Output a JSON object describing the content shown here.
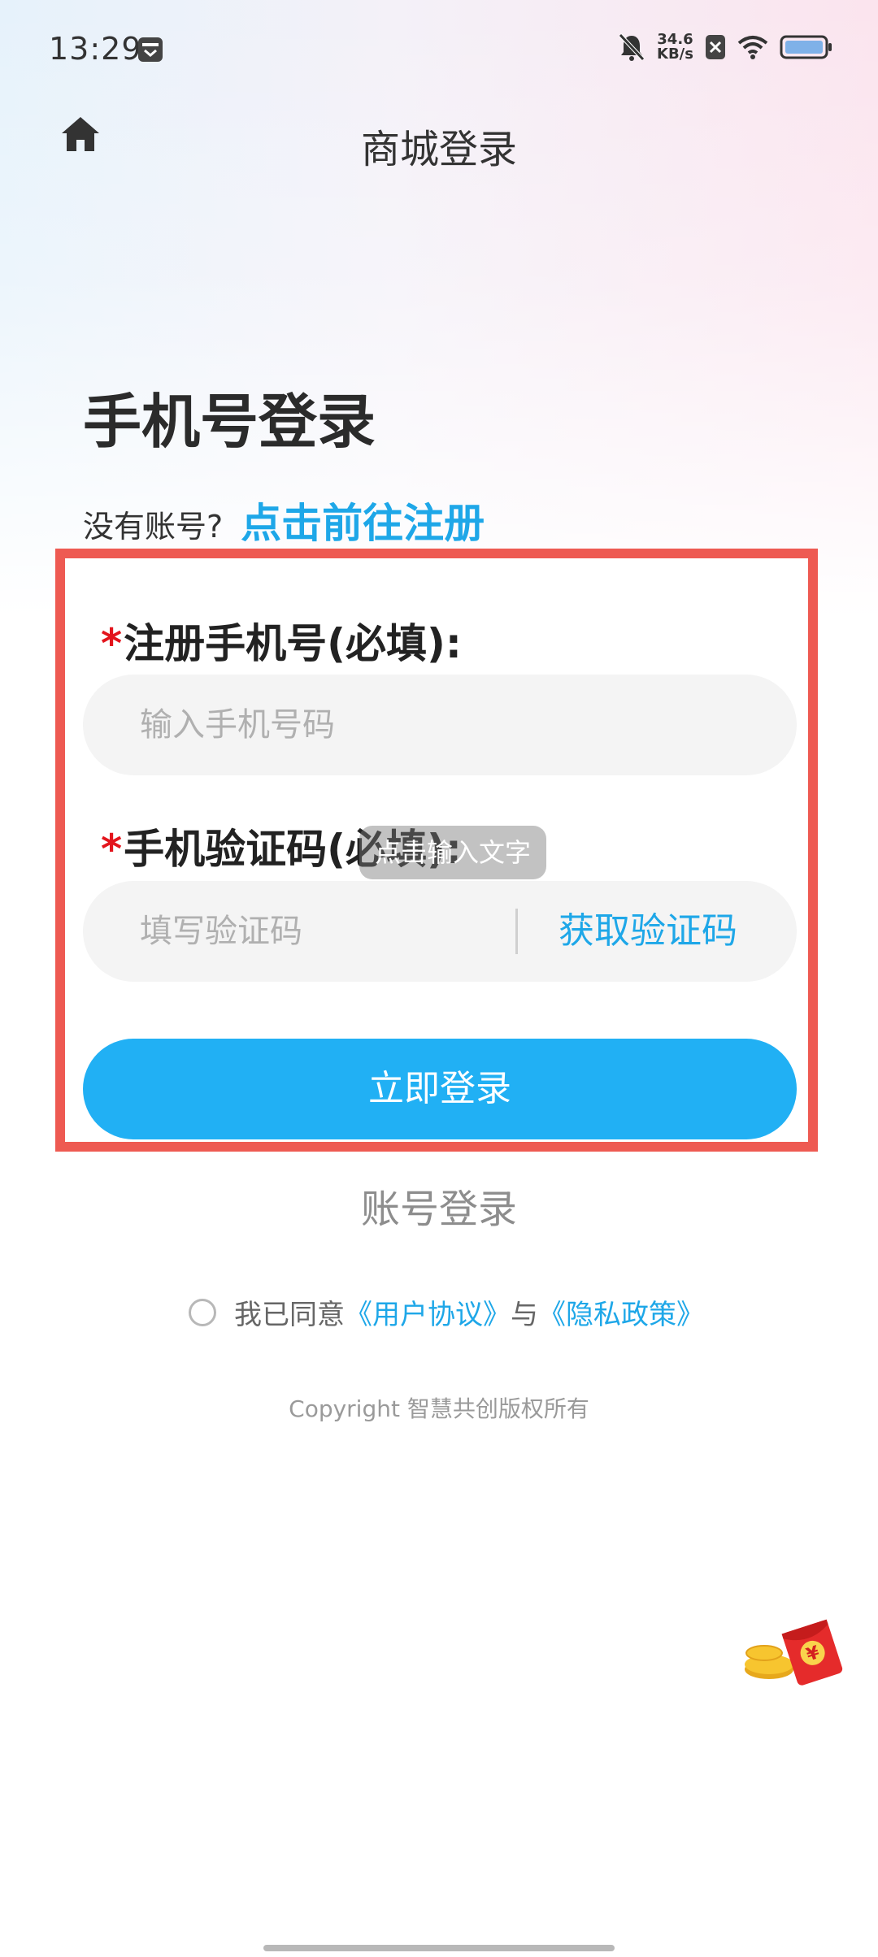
{
  "status_bar": {
    "time": "13:29",
    "net_speed_value": "34.6",
    "net_speed_unit": "KB/s",
    "icons": [
      "calendar-icon",
      "mute-icon",
      "sim-off-icon",
      "wifi-icon",
      "battery-icon"
    ]
  },
  "header": {
    "home_icon": "home-icon",
    "title": "商城登录"
  },
  "main": {
    "heading": "手机号登录",
    "no_account_text": "没有账号?",
    "register_link": "点击前往注册"
  },
  "form": {
    "phone_label": "注册手机号(必填):",
    "phone_placeholder": "输入手机号码",
    "code_label": "手机验证码(必填):",
    "code_placeholder": "填写验证码",
    "get_code_label": "获取验证码",
    "required_mark": "*",
    "submit_label": "立即登录"
  },
  "tooltip": {
    "text": "点击输入文字"
  },
  "account_login_label": "账号登录",
  "agreement": {
    "prefix": "我已同意",
    "user_agreement": "《用户协议》",
    "conjunction": "与",
    "privacy_policy": "《隐私政策》"
  },
  "copyright": "Copyright 智慧共创版权所有",
  "colors": {
    "accent": "#21b0f4",
    "link": "#1ea7e8",
    "highlight_border": "#ee5a52",
    "required": "#e3141c"
  }
}
